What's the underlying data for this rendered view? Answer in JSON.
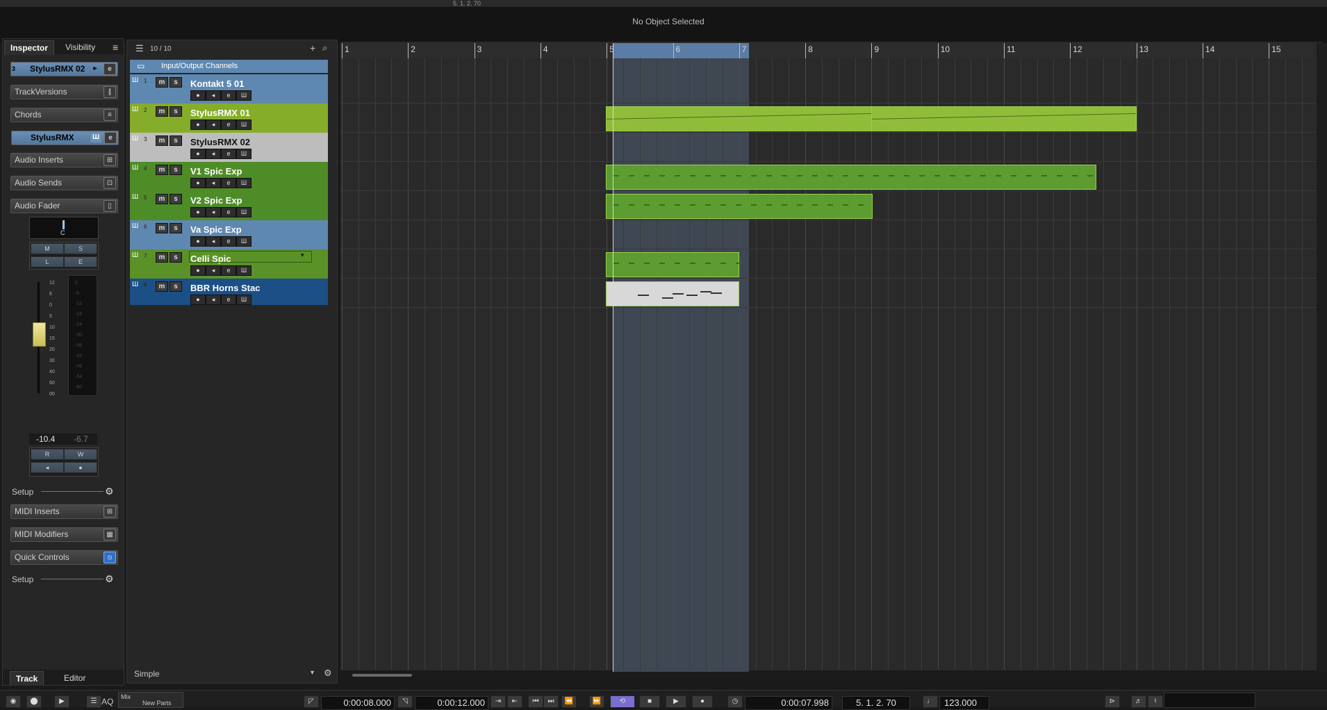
{
  "info_line": {
    "status": "No Object Selected",
    "top_position": "5. 1. 2. 70"
  },
  "inspector": {
    "tabs": [
      "Inspector",
      "Visibility"
    ],
    "menu_icon": "hamburger-icon",
    "track_name": "StylusRMX 02",
    "sections": [
      "TrackVersions",
      "Chords"
    ],
    "instrument": "StylusRMX",
    "audio_sections": [
      "Audio Inserts",
      "Audio Sends",
      "Audio Fader"
    ],
    "pan_value": "C",
    "mslE": [
      "M",
      "S",
      "L",
      "E"
    ],
    "fader_scale": [
      "12",
      "6",
      "0",
      "5",
      "10",
      "15",
      "20",
      "30",
      "40",
      "60",
      "00"
    ],
    "meter_scale": [
      "0",
      "-6",
      "-12",
      "-18",
      "-24",
      "-30",
      "-36",
      "-42",
      "-48",
      "-54",
      "-60"
    ],
    "volume_value": "-10.4",
    "peak_value": "-6.7",
    "rw": [
      "R",
      "W"
    ],
    "setup_label": "Setup",
    "midi_sections": [
      "MIDI Inserts",
      "MIDI Modifiers",
      "Quick Controls"
    ],
    "setup_label2": "Setup",
    "bottom_tabs": [
      "Track",
      "Editor"
    ]
  },
  "tracklist": {
    "count": "10 / 10",
    "folder": "Input/Output Channels",
    "preset": "Simple",
    "tracks": [
      {
        "num": "1",
        "name": "Kontakt 5 01",
        "color": "#5f88b0",
        "text_color": "#ffffff"
      },
      {
        "num": "2",
        "name": "StylusRMX 01",
        "color": "#86ad2a",
        "text_color": "#ffffff"
      },
      {
        "num": "3",
        "name": "StylusRMX 02",
        "color": "#bdbdbd",
        "text_color": "#111111"
      },
      {
        "num": "4",
        "name": "V1 Spic Exp",
        "color": "#4e8c28",
        "text_color": "#ffffff"
      },
      {
        "num": "5",
        "name": "V2 Spic Exp",
        "color": "#4e8c28",
        "text_color": "#ffffff"
      },
      {
        "num": "6",
        "name": "Va Spic Exp",
        "color": "#5f88b0",
        "text_color": "#ffffff"
      },
      {
        "num": "7",
        "name": "Celli Spic",
        "color": "#5a9228",
        "text_color": "#ffffff"
      },
      {
        "num": "8",
        "name": "BBR Horns Stac",
        "color": "#1b4f86",
        "text_color": "#ffffff"
      }
    ],
    "ms_labels": [
      "m",
      "s"
    ],
    "ctl_labels": [
      "●",
      "◂",
      "e",
      "Ш"
    ]
  },
  "ruler": {
    "bars": [
      "1",
      "2",
      "3",
      "4",
      "5",
      "6",
      "7",
      "8",
      "9",
      "10",
      "11",
      "12",
      "13",
      "14",
      "15"
    ]
  },
  "transport": {
    "mode": "Mix",
    "new_parts": "New Parts",
    "aq": "AQ",
    "left_locator": "0:00:08.000",
    "right_locator": "0:00:12.000",
    "time": "0:00:07.998",
    "bars": "5. 1. 2. 70",
    "tempo": "123.000"
  }
}
